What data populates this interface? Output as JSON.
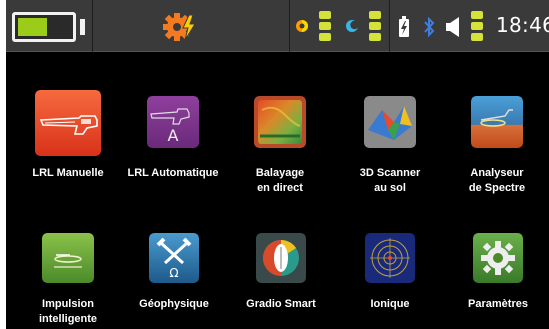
{
  "status_bar": {
    "battery_main": {
      "level": 0.55,
      "color": "#9ccc1a"
    },
    "icons": {
      "settings_alert": "gear-lightning-icon",
      "half_circle": "contrast-icon",
      "moon": "crescent-icon",
      "battery_small": "battery-charging-icon",
      "bluetooth": "bluetooth-icon",
      "volume": "speaker-icon"
    },
    "gauge_color": "#d4e23a",
    "time": "18:46"
  },
  "apps": [
    {
      "label": "LRL Manuelle",
      "icon": "lrl-manual-icon"
    },
    {
      "label": "LRL Automatique",
      "icon": "lrl-automatic-icon"
    },
    {
      "label": "Balayage\nen direct",
      "icon": "live-scan-icon"
    },
    {
      "label": "3D Scanner\nau sol",
      "icon": "ground-3d-scanner-icon"
    },
    {
      "label": "Analyseur\nde Spectre",
      "icon": "spectrum-analyzer-icon"
    },
    {
      "label": "Impulsion\nintelligente",
      "icon": "smart-pulse-icon"
    },
    {
      "label": "Géophysique",
      "icon": "geophysics-icon"
    },
    {
      "label": "Gradio Smart",
      "icon": "gradio-smart-icon"
    },
    {
      "label": "Ionique",
      "icon": "ionic-icon"
    },
    {
      "label": "Paramètres",
      "icon": "settings-icon"
    }
  ]
}
